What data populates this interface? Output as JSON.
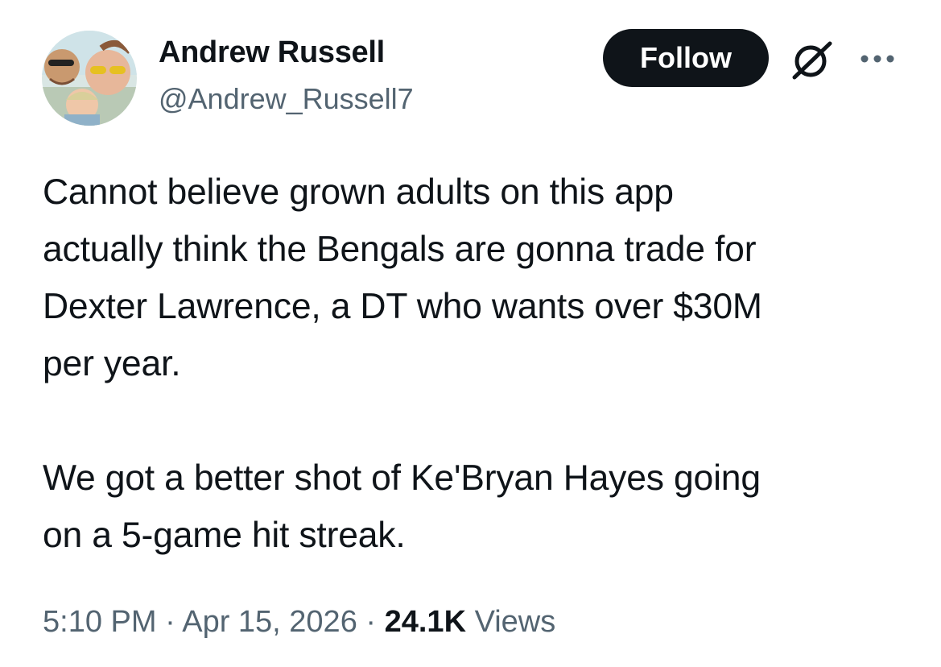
{
  "author": {
    "display_name": "Andrew Russell",
    "handle": "@Andrew_Russell7",
    "avatar_icon": "profile-photo"
  },
  "header": {
    "follow_label": "Follow",
    "grok_icon": "grok-icon",
    "more_icon": "more-options-icon"
  },
  "tweet": {
    "text": "Cannot believe grown adults on this app\nactually think the Bengals are gonna trade for\nDexter Lawrence, a DT who wants over $30M\nper year.\n\nWe got a better shot of Ke'Bryan Hayes going\non a 5-game hit streak."
  },
  "meta": {
    "time": "5:10 PM",
    "separator": " · ",
    "date": "Apr 15, 2026",
    "views_count": "24.1K",
    "views_label": " Views"
  },
  "colors": {
    "text": "#0f1419",
    "secondary": "#536471",
    "button_bg": "#0f1419",
    "button_text": "#ffffff"
  }
}
